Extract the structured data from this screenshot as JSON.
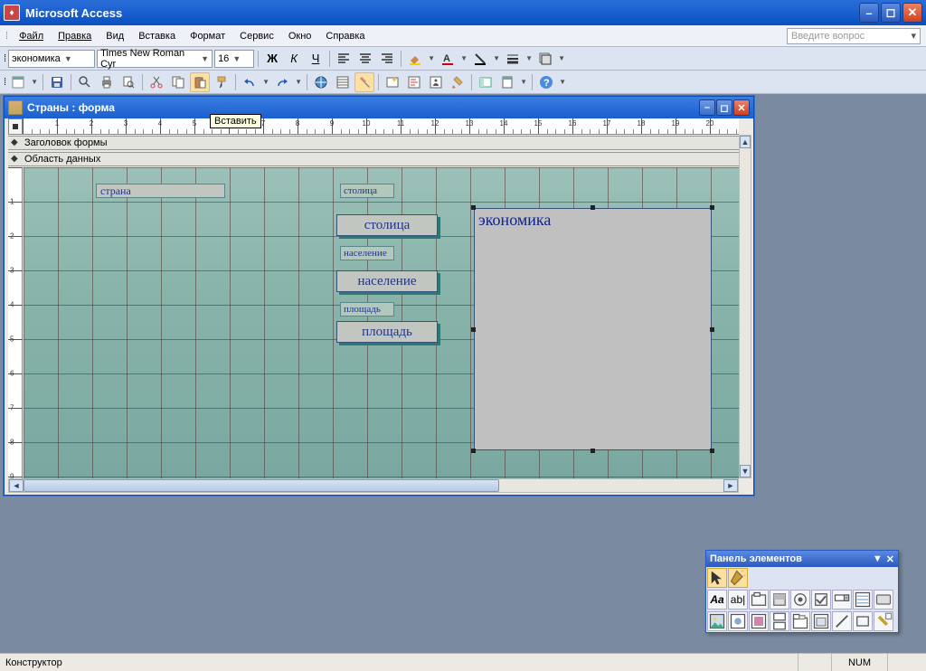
{
  "app": {
    "title": "Microsoft Access"
  },
  "menu": {
    "file": "Файл",
    "edit": "Правка",
    "view": "Вид",
    "insert": "Вставка",
    "format": "Формат",
    "service": "Сервис",
    "window": "Окно",
    "help": "Справка",
    "help_placeholder": "Введите вопрос"
  },
  "format_toolbar": {
    "object_combo": "экономика",
    "font_combo": "Times New Roman Cyr",
    "size_combo": "16",
    "bold": "Ж",
    "italic": "К",
    "underline": "Ч"
  },
  "tooltip": {
    "insert": "Вставить"
  },
  "form_window": {
    "title": "Страны : форма",
    "sections": {
      "header": "Заголовок формы",
      "detail": "Область данных"
    },
    "controls": {
      "country_label": "страна",
      "capital_small": "столица",
      "capital_btn": "столица",
      "population_small": "население",
      "population_btn": "население",
      "area_small": "площадь",
      "area_btn": "площадь",
      "economy_field": "экономика"
    }
  },
  "toolbox": {
    "title": "Панель элементов"
  },
  "status": {
    "mode": "Конструктор",
    "num": "NUM"
  }
}
